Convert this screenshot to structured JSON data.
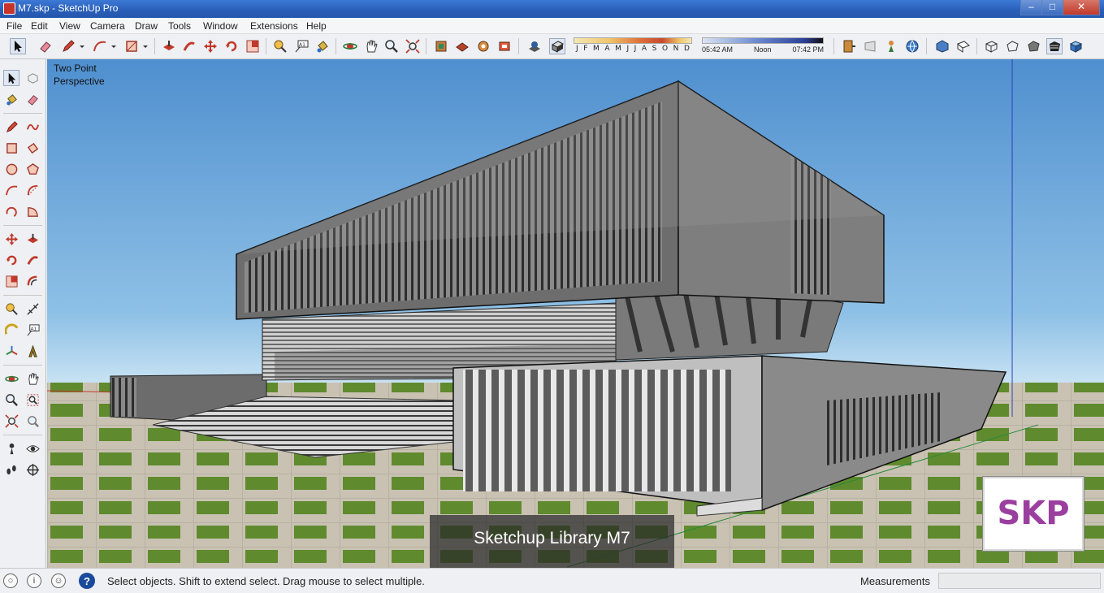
{
  "window": {
    "title": "M7.skp - SketchUp Pro",
    "min_glyph": "–",
    "max_glyph": "□",
    "close_glyph": "✕"
  },
  "menu": [
    "File",
    "Edit",
    "View",
    "Camera",
    "Draw",
    "Tools",
    "Window",
    "Extensions",
    "Help"
  ],
  "shadow_settings": {
    "months": [
      "J",
      "F",
      "M",
      "A",
      "M",
      "J",
      "J",
      "A",
      "S",
      "O",
      "N",
      "D"
    ],
    "time_start": "05:42 AM",
    "time_mid": "Noon",
    "time_end": "07:42 PM"
  },
  "viewport": {
    "view_label_line1": "Two Point",
    "view_label_line2": "Perspective",
    "caption": "Sketchup Library M7",
    "logo_text": "SKP"
  },
  "status": {
    "info_icons": [
      "○",
      "i",
      "☺"
    ],
    "help_glyph": "?",
    "message": "Select objects. Shift to extend select. Drag mouse to select multiple.",
    "measurements_label": "Measurements",
    "measurements_value": ""
  },
  "colors": {
    "sky_top": "#4f8fcf",
    "sky_horizon": "#cfe6f5",
    "grass": "#5f8a2e",
    "paving": "#c9c2b3",
    "concrete": "#7d7d7d",
    "logo_purple": "#9b3f9f"
  }
}
